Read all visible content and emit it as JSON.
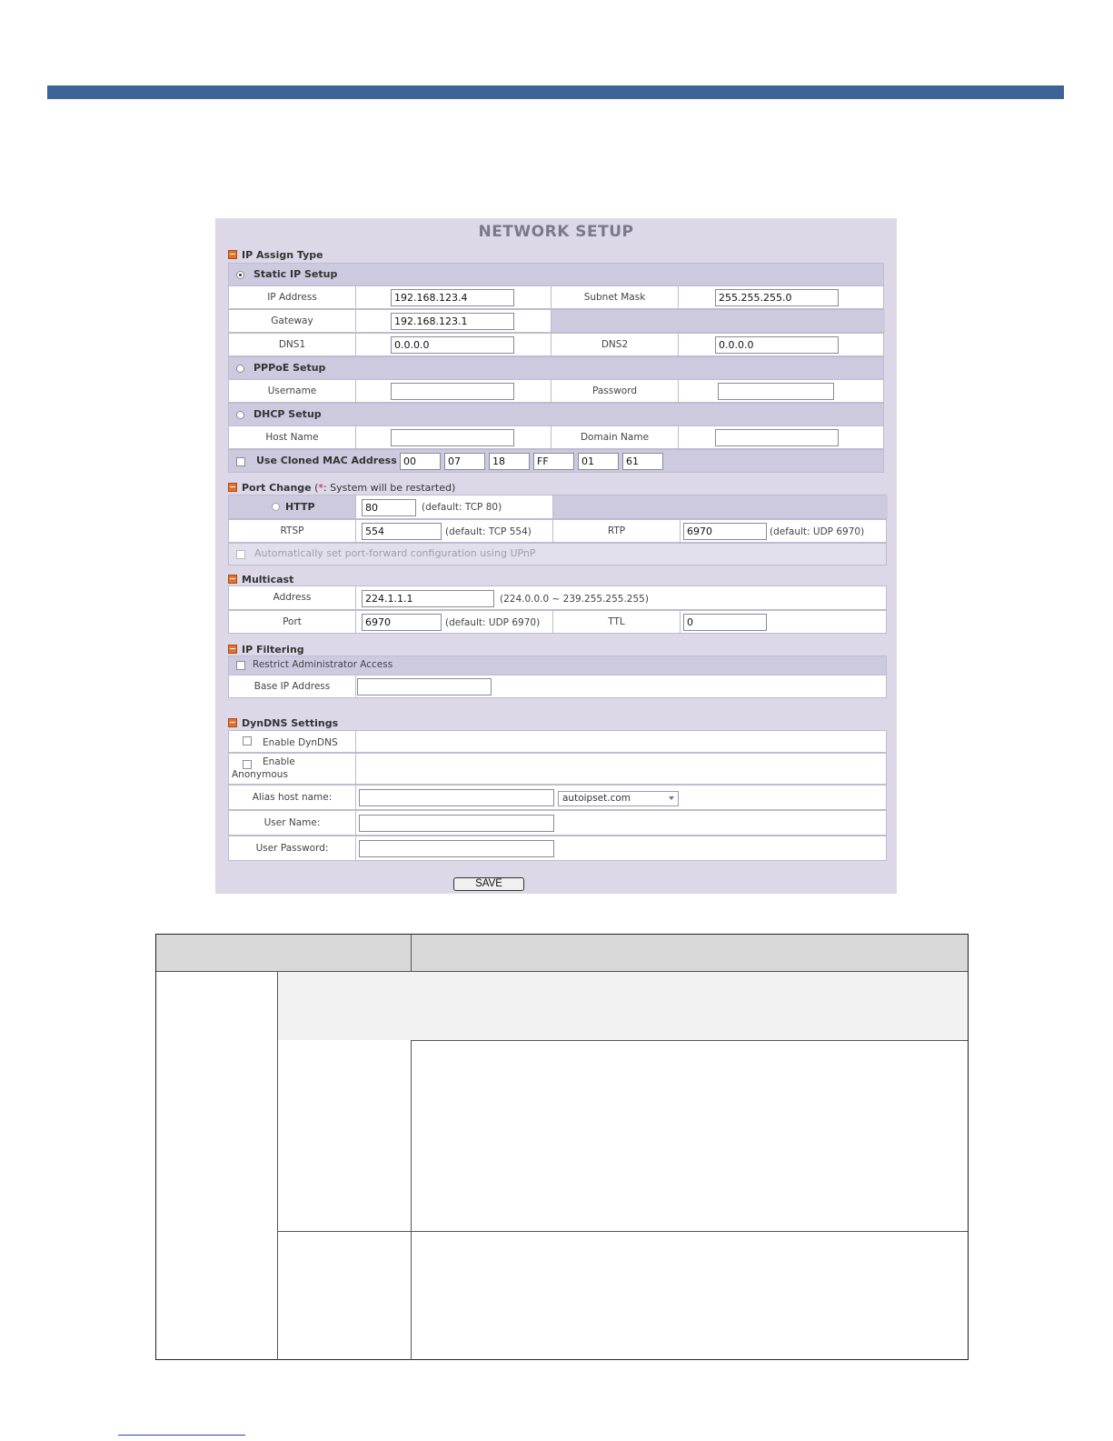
{
  "panel": {
    "title": "NETWORK SETUP",
    "save_label": "SAVE"
  },
  "ip_assign": {
    "section_title": "IP Assign Type",
    "static": {
      "label": "Static IP Setup",
      "selected": true,
      "ip_address_label": "IP Address",
      "ip_address_value": "192.168.123.4",
      "subnet_mask_label": "Subnet Mask",
      "subnet_mask_value": "255.255.255.0",
      "gateway_label": "Gateway",
      "gateway_value": "192.168.123.1",
      "dns1_label": "DNS1",
      "dns1_value": "0.0.0.0",
      "dns2_label": "DNS2",
      "dns2_value": "0.0.0.0"
    },
    "pppoe": {
      "label": "PPPoE Setup",
      "username_label": "Username",
      "username_value": "",
      "password_label": "Password",
      "password_value": ""
    },
    "dhcp": {
      "label": "DHCP Setup",
      "host_name_label": "Host Name",
      "host_name_value": "",
      "domain_name_label": "Domain Name",
      "domain_name_value": ""
    },
    "cloned_mac": {
      "label": "Use Cloned MAC Address",
      "octets": [
        "00",
        "07",
        "18",
        "FF",
        "01",
        "61"
      ]
    }
  },
  "port_change": {
    "section_title": "Port Change",
    "note_open": " (",
    "note_star": "*",
    "note_text": ": System will be restarted)",
    "http_label": "HTTP",
    "http_value": "80",
    "http_hint": "(default: TCP 80)",
    "rtsp_label": "RTSP",
    "rtsp_value": "554",
    "rtsp_hint": "(default: TCP 554)",
    "rtp_label": "RTP",
    "rtp_value": "6970",
    "rtp_hint": "(default: UDP 6970)",
    "upnp_label": "Automatically set port-forward configuration using UPnP"
  },
  "multicast": {
    "section_title": "Multicast",
    "address_label": "Address",
    "address_value": "224.1.1.1",
    "address_hint": "(224.0.0.0 ~ 239.255.255.255)",
    "port_label": "Port",
    "port_value": "6970",
    "port_hint": "(default: UDP 6970)",
    "ttl_label": "TTL",
    "ttl_value": "0"
  },
  "ip_filtering": {
    "section_title": "IP Filtering",
    "restrict_label": "Restrict Administrator Access",
    "base_ip_label": "Base IP Address",
    "base_ip_value": ""
  },
  "dyndns": {
    "section_title": "DynDNS Settings",
    "enable_label": "Enable DynDNS",
    "anon_label_1": "Enable",
    "anon_label_2": "Anonymous",
    "alias_label": "Alias host name:",
    "alias_value": "",
    "domain_selected": "autoipset.com",
    "user_name_label": "User Name:",
    "user_name_value": "",
    "user_password_label": "User Password:",
    "user_password_value": ""
  },
  "colors": {
    "top_bar": "#3c6496",
    "panel_bg": "#dcd8e8",
    "header_row": "#cdcae0",
    "section_marker": "#e4702d"
  }
}
